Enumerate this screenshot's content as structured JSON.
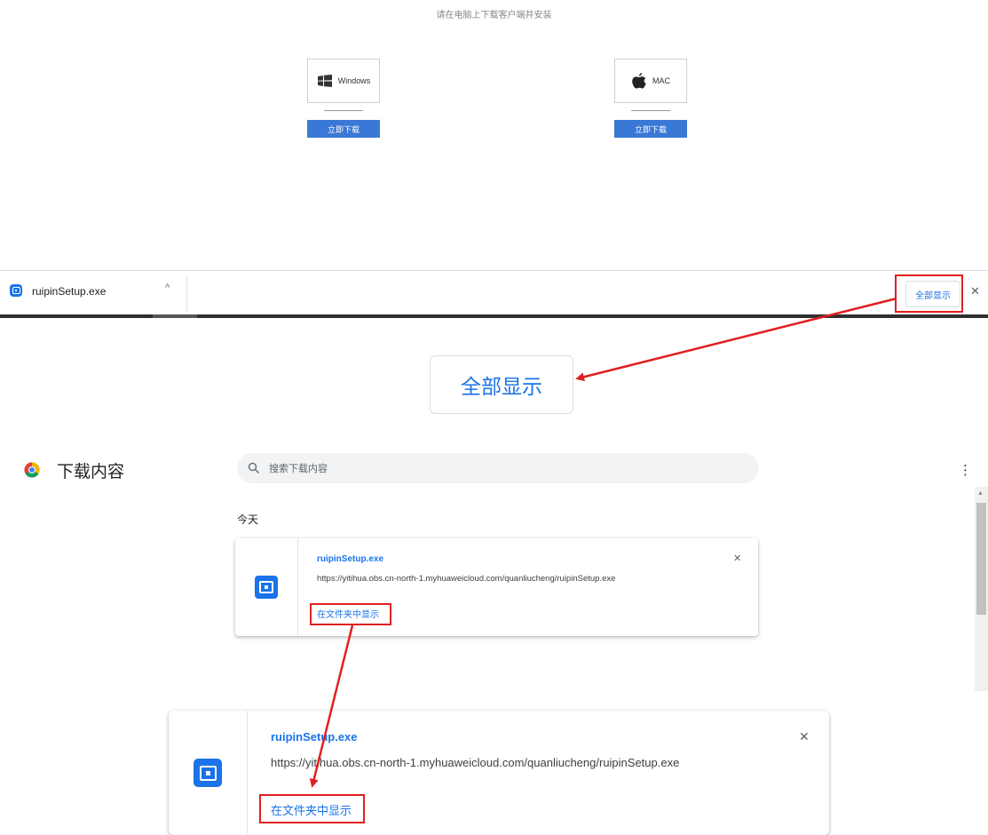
{
  "top_page": {
    "hint": "请在电脑上下载客户端并安装",
    "windows_label": "Windows",
    "mac_label": "MAC",
    "download_button": "立即下载"
  },
  "shelf": {
    "filename": "ruipinSetup.exe",
    "show_all": "全部显示",
    "close": "✕",
    "chevron": "^"
  },
  "callout_show_all": "全部显示",
  "downloads": {
    "title": "下载内容",
    "search_placeholder": "搜索下载内容",
    "menu": "⋮",
    "date_group": "今天",
    "item": {
      "filename": "ruipinSetup.exe",
      "url": "https://yitihua.obs.cn-north-1.myhuaweicloud.com/quanliucheng/ruipinSetup.exe",
      "show_in_folder": "在文件夹中显示",
      "remove": "✕"
    }
  },
  "zoom_item": {
    "filename": "ruipinSetup.exe",
    "url": "https://yitihua.obs.cn-north-1.myhuaweicloud.com/quanliucheng/ruipinSetup.exe",
    "show_in_folder": "在文件夹中显示",
    "remove": "✕"
  },
  "colors": {
    "accent": "#1a73e8",
    "highlight": "#e02020",
    "download_button": "#3a78d6"
  }
}
